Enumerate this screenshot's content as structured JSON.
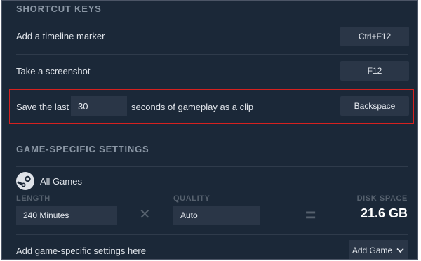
{
  "shortcut_keys": {
    "title": "SHORTCUT KEYS",
    "rows": [
      {
        "label": "Add a timeline marker",
        "key": "Ctrl+F12"
      },
      {
        "label": "Take a screenshot",
        "key": "F12"
      }
    ],
    "clip": {
      "prefix": "Save the last",
      "seconds": "30",
      "suffix": "seconds of gameplay as a clip",
      "key": "Backspace"
    }
  },
  "game_settings": {
    "title": "GAME-SPECIFIC SETTINGS",
    "game_name": "All Games",
    "length_label": "LENGTH",
    "length_value": "240 Minutes",
    "multiply_symbol": "✕",
    "quality_label": "QUALITY",
    "quality_value": "Auto",
    "equals_symbol": "=",
    "disk_space_label": "DISK SPACE",
    "disk_space_value": "21.6 GB",
    "add_label": "Add game-specific settings here",
    "add_button": "Add Game",
    "add_button_icon": "chevron-down-icon"
  },
  "colors": {
    "background": "#1b2838",
    "control": "#2a3647",
    "highlight_border": "#d6211f"
  }
}
